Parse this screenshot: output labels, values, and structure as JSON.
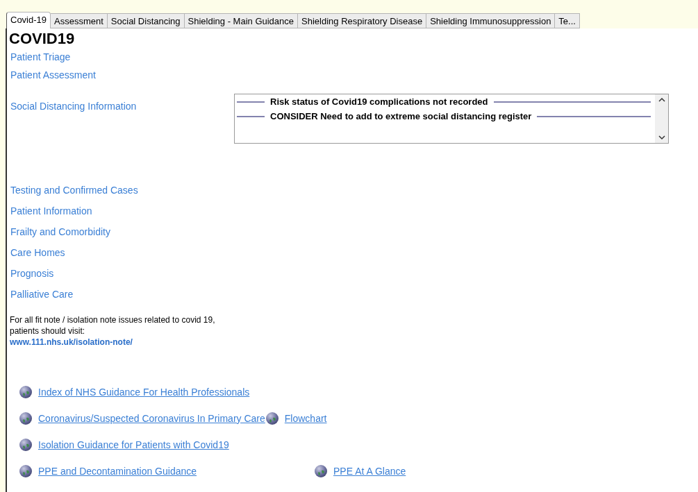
{
  "tabs": [
    {
      "label": "Covid-19",
      "selected": true
    },
    {
      "label": "Assessment",
      "selected": false
    },
    {
      "label": "Social Distancing",
      "selected": false
    },
    {
      "label": "Shielding - Main Guidance",
      "selected": false
    },
    {
      "label": "Shielding Respiratory Disease",
      "selected": false
    },
    {
      "label": "Shielding Immunosuppression",
      "selected": false
    },
    {
      "label": "Te...",
      "selected": false
    }
  ],
  "heading": "COVID19",
  "top_links": [
    "Patient Triage",
    "Patient Assessment"
  ],
  "social_distancing": {
    "link": "Social Distancing Information",
    "alerts": [
      "Risk status of Covid19 complications not recorded",
      "CONSIDER Need to add to extreme social distancing register"
    ]
  },
  "more_links": [
    "Testing and Confirmed Cases",
    "Patient Information",
    "Frailty and Comorbidity",
    "Care Homes",
    "Prognosis",
    "Palliative Care"
  ],
  "note": {
    "text": "For all fit note / isolation note issues related to covid 19, patients should visit:",
    "url": "www.111.nhs.uk/isolation-note/"
  },
  "guidance_rows": [
    {
      "kind": "tight",
      "items": [
        "Index of NHS Guidance For Health Professionals"
      ]
    },
    {
      "kind": "tight",
      "items": [
        "Coronavirus/Suspected Coronavirus In Primary Care",
        "Flowchart"
      ]
    },
    {
      "kind": "tight",
      "items": [
        "Isolation Guidance for Patients with Covid19"
      ]
    },
    {
      "kind": "spaced",
      "items": [
        "PPE and Decontamination Guidance",
        "PPE At A Glance"
      ]
    }
  ]
}
